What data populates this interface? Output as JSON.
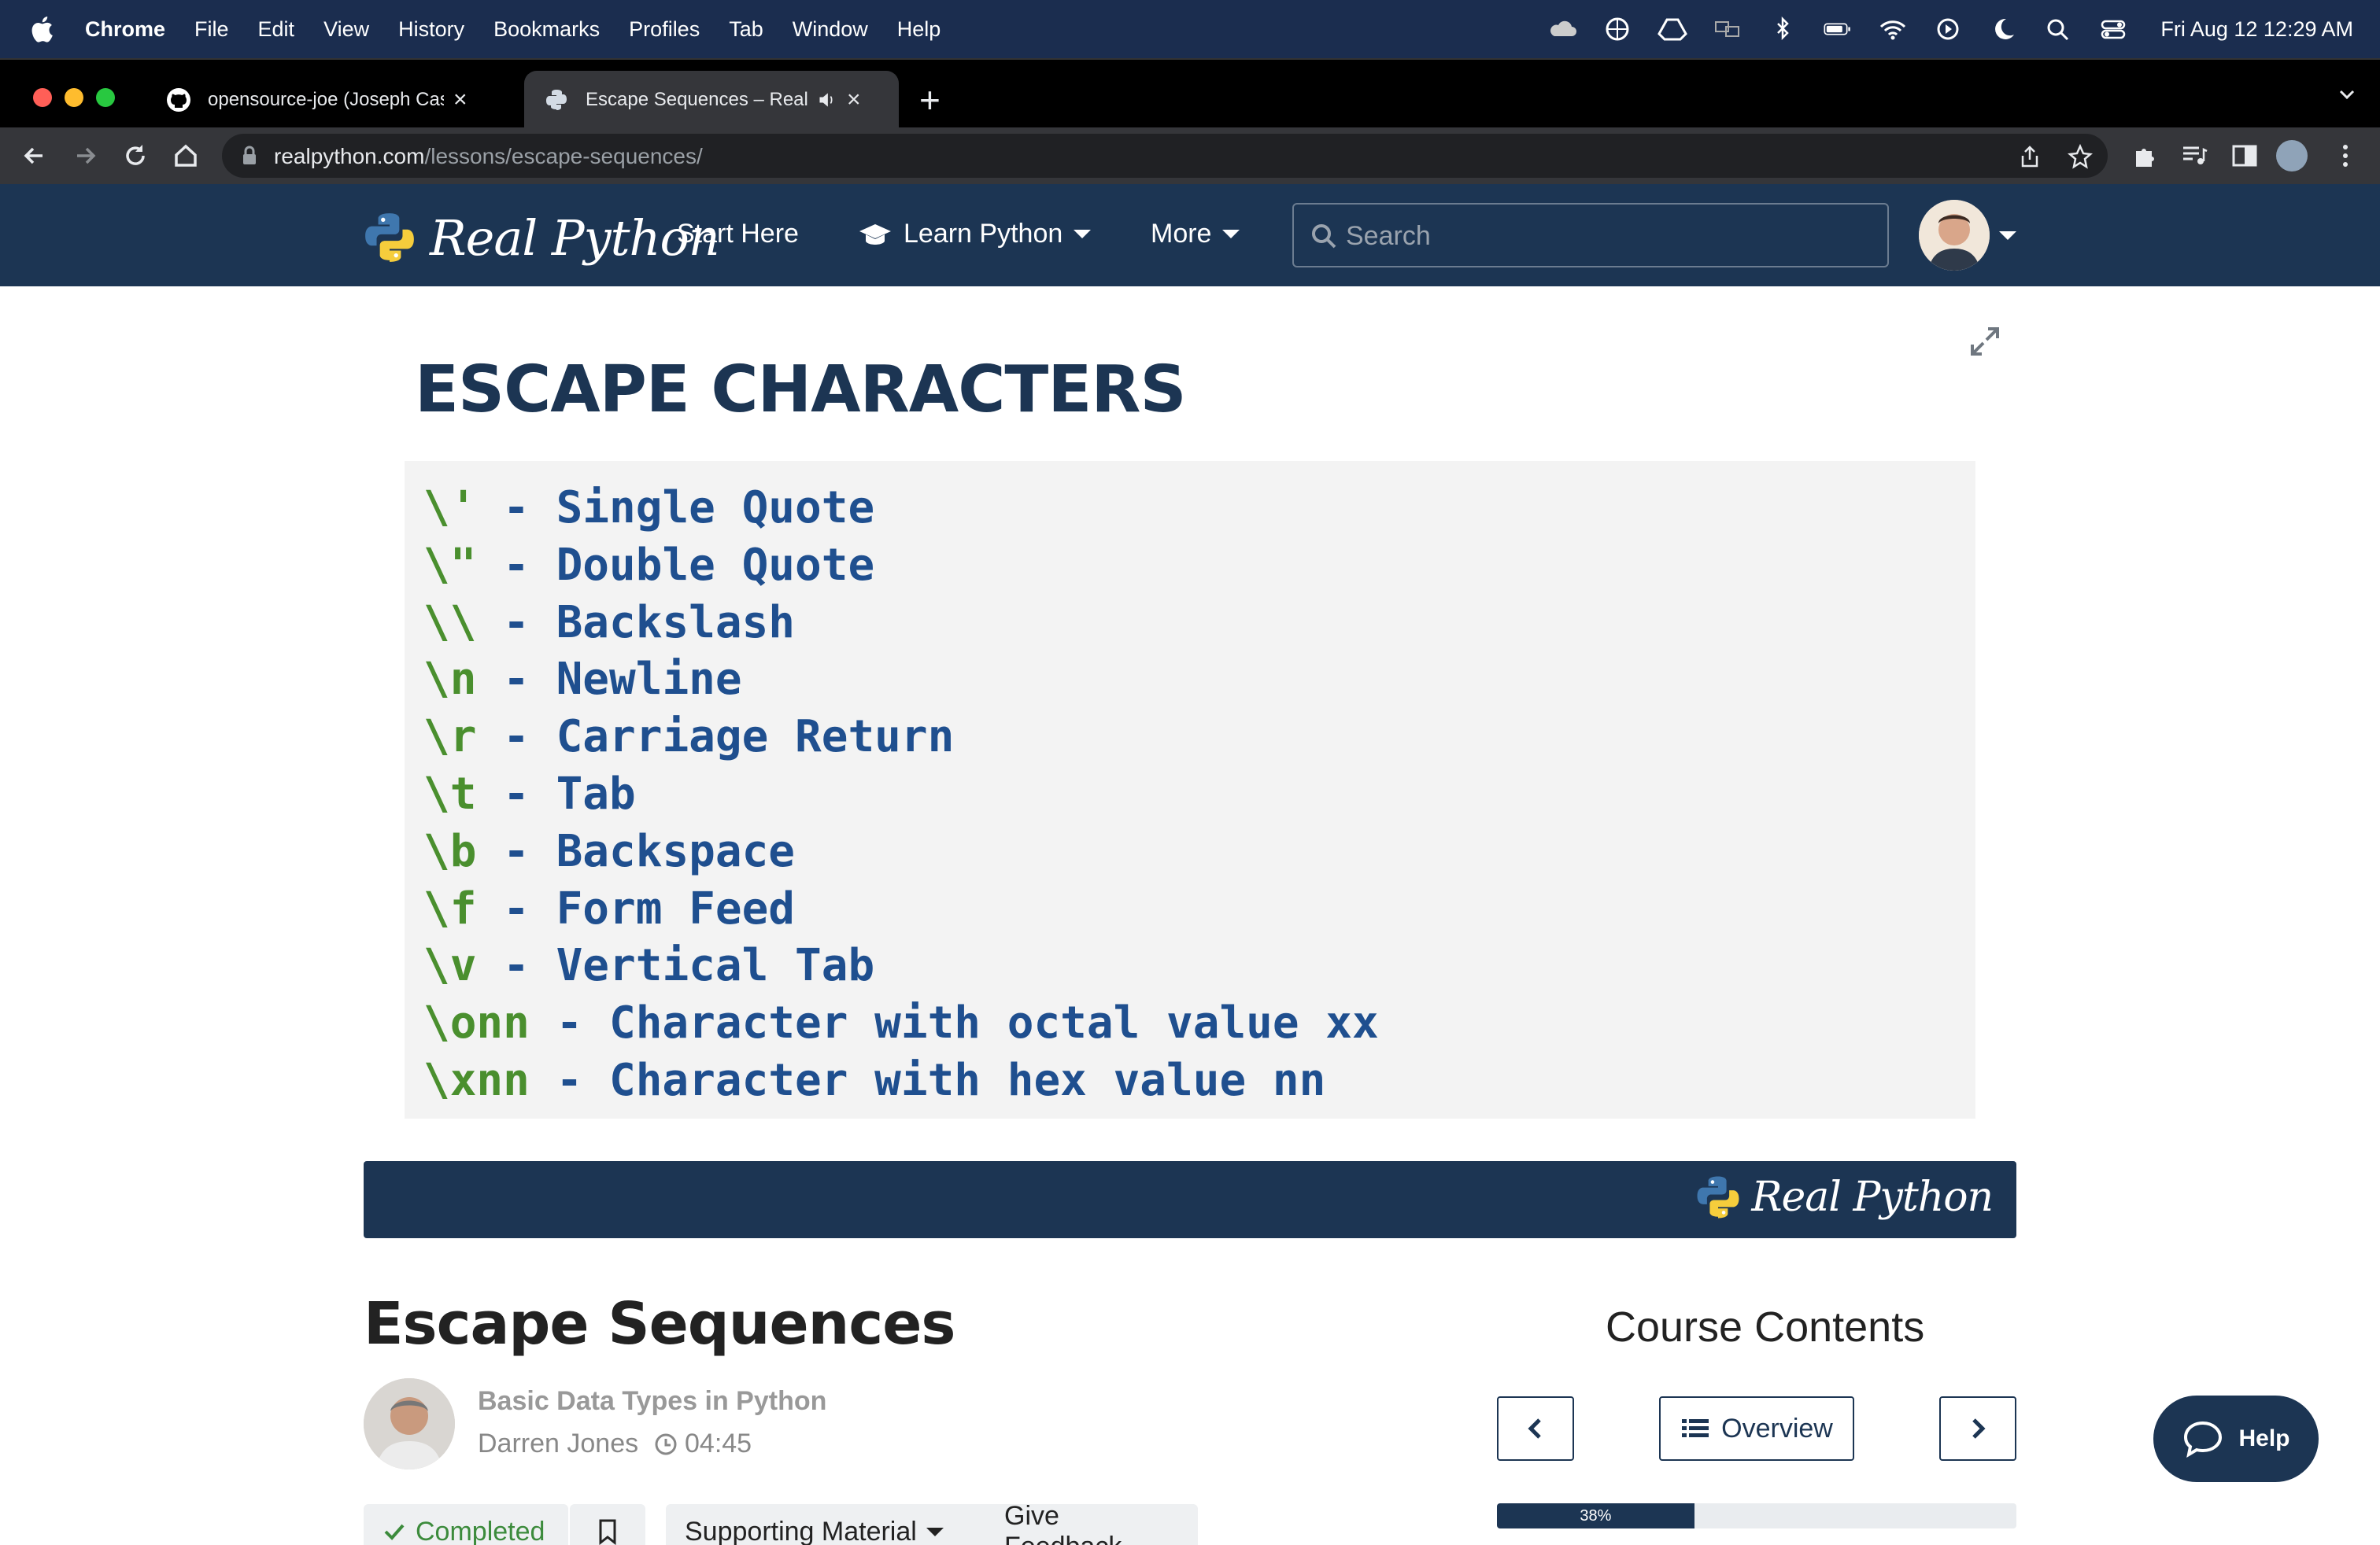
{
  "menubar": {
    "app": "Chrome",
    "items": [
      "File",
      "Edit",
      "View",
      "History",
      "Bookmarks",
      "Profiles",
      "Tab",
      "Window",
      "Help"
    ],
    "clock": "Fri Aug 12  12:29 AM"
  },
  "tabs": [
    {
      "title": "opensource-joe (Joseph Castle)",
      "icon": "github-icon"
    },
    {
      "title": "Escape Sequences – Real Python",
      "icon": "realpython-favicon"
    }
  ],
  "address": {
    "host": "realpython.com",
    "path": "/lessons/escape-sequences/"
  },
  "navbar": {
    "logo_text": "Real Python",
    "start_here": "Start Here",
    "learn_python": "Learn Python",
    "more": "More",
    "search_placeholder": "Search"
  },
  "slide": {
    "title": "ESCAPE CHARACTERS",
    "lines": [
      {
        "code": "\\'",
        "desc": " - Single Quote"
      },
      {
        "code": "\\\"",
        "desc": " - Double Quote"
      },
      {
        "code": "\\\\",
        "desc": " - Backslash"
      },
      {
        "code": "\\n",
        "desc": " - Newline"
      },
      {
        "code": "\\r",
        "desc": " - Carriage Return"
      },
      {
        "code": "\\t",
        "desc": " - Tab"
      },
      {
        "code": "\\b",
        "desc": " - Backspace"
      },
      {
        "code": "\\f",
        "desc": " - Form Feed"
      },
      {
        "code": "\\v",
        "desc": " - Vertical Tab"
      },
      {
        "code": "\\onn",
        "desc": " - Character with octal value xx"
      },
      {
        "code": "\\xnn",
        "desc": " - Character with hex value nn"
      }
    ],
    "banner_logo_text": "Real Python"
  },
  "lesson": {
    "title": "Escape Sequences",
    "course": "Basic Data Types in Python",
    "author": "Darren Jones",
    "duration": "04:45",
    "completed_label": "Completed",
    "supporting_label": "Supporting Material",
    "feedback_label": "Give Feedback"
  },
  "course_contents": {
    "title": "Course Contents",
    "overview_label": "Overview",
    "progress_label": "38%",
    "progress": 0.38
  },
  "help_label": "Help",
  "colors": {
    "navy": "#1c3553",
    "code_green": "#4a8f2e",
    "code_blue": "#1f4f8f"
  }
}
